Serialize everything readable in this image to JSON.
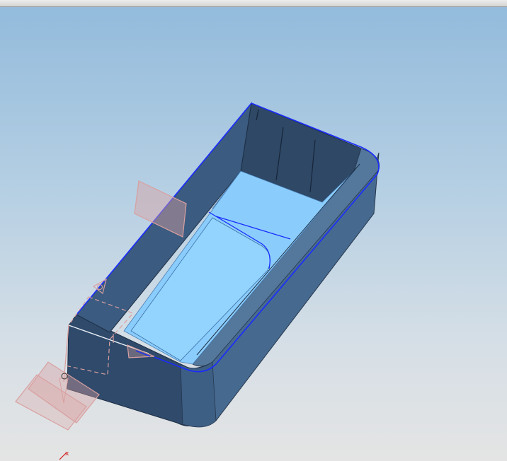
{
  "viewport": {
    "background_top": "#93bbdc",
    "background_bottom": "#e4e4e4"
  },
  "model": {
    "shell_color": "#2f4a6b",
    "wall_color": "#46698f",
    "floor_color": "#8acdfc",
    "highlight_edge_color": "#1a2cff",
    "datum_plane_color": "#d9a0a0"
  },
  "triad": {
    "x_label": "x",
    "axis_color": "#d22020"
  },
  "icons": [
    "datum-plane-icon",
    "csys-triad-icon",
    "arrow-marker-icon"
  ]
}
